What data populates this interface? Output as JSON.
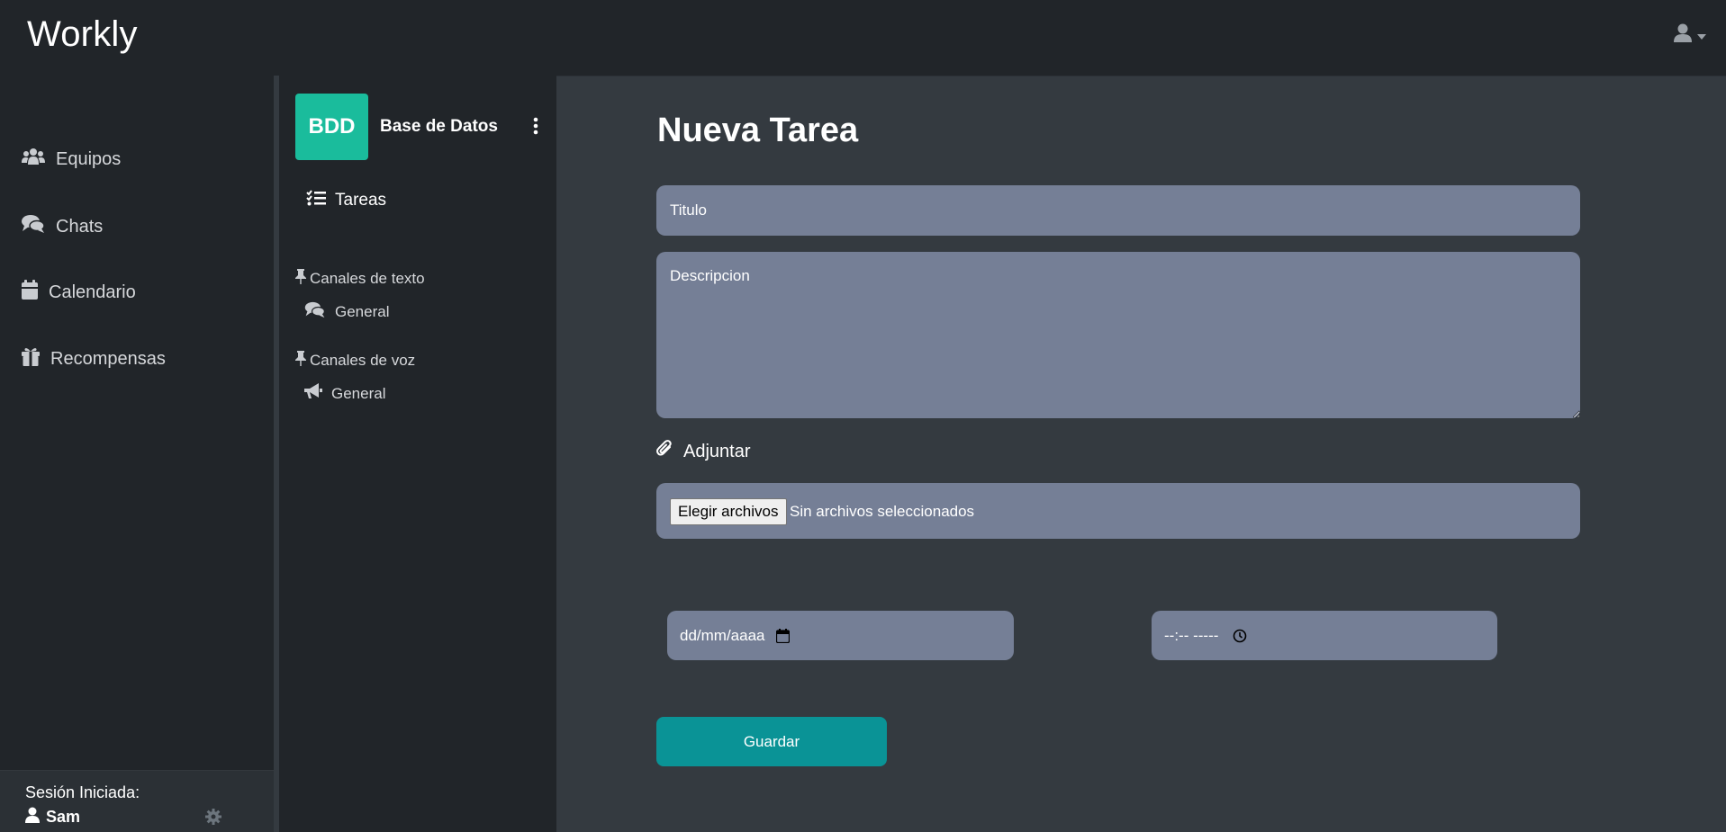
{
  "app": {
    "brand": "Workly"
  },
  "header": {
    "user_icon": "user-icon",
    "dropdown_icon": "caret-down-icon"
  },
  "sidebar": {
    "items": [
      {
        "label": "Equipos",
        "icon": "users-icon"
      },
      {
        "label": "Chats",
        "icon": "comments-icon"
      },
      {
        "label": "Calendario",
        "icon": "calendar-icon"
      },
      {
        "label": "Recompensas",
        "icon": "gift-icon"
      }
    ],
    "session": {
      "label": "Sesión Iniciada:",
      "user": "Sam",
      "settings_icon": "gear-icon"
    }
  },
  "team": {
    "badge": "BDD",
    "name": "Base de Datos",
    "menu_icon": "vertical-dots-icon",
    "tasks_label": "Tareas",
    "text_channels": {
      "title": "Canales de texto",
      "items": [
        "General"
      ]
    },
    "voice_channels": {
      "title": "Canales de voz",
      "items": [
        "General"
      ]
    }
  },
  "form": {
    "title": "Nueva Tarea",
    "title_placeholder": "Titulo",
    "description_placeholder": "Descripcion",
    "attach_label": "Adjuntar",
    "file_button": "Elegir archivos",
    "file_status": "Sin archivos seleccionados",
    "date_placeholder": "dd/mm/aaaa",
    "time_placeholder": "--:-- -----",
    "save_label": "Guardar"
  },
  "colors": {
    "top_bar": "#212529",
    "sidebar": "#212529",
    "main_bg": "#343a40",
    "input_bg": "#757f96",
    "team_badge": "#1abc9c",
    "save_button": "#0a9396"
  }
}
